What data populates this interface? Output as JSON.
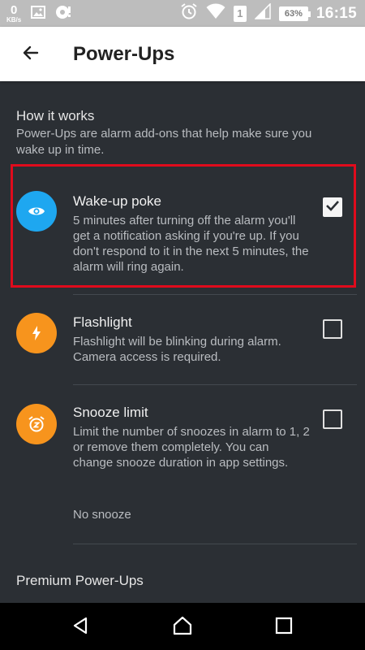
{
  "status_bar": {
    "speed_value": "0",
    "speed_unit": "KB/s",
    "sim_slot": "1",
    "battery_percent": "63%",
    "time": "16:15"
  },
  "app_bar": {
    "title": "Power-Ups"
  },
  "how_it_works": {
    "heading": "How it works",
    "description": "Power-Ups are alarm add-ons that help make sure you wake up in time."
  },
  "power_ups": [
    {
      "title": "Wake-up poke",
      "description": "5 minutes after turning off the alarm you'll get a notification asking if you're up. If you don't respond to it in the next 5 minutes, the alarm will ring again.",
      "checked": true,
      "icon": "eye-icon",
      "color": "#1ea7f0"
    },
    {
      "title": "Flashlight",
      "description": "Flashlight will be blinking during alarm. Camera access is required.",
      "checked": false,
      "icon": "lightning-icon",
      "color": "#f7941d"
    },
    {
      "title": "Snooze limit",
      "description": "Limit the number of snoozes in alarm to 1, 2 or remove them completely. You can change snooze duration in app settings.",
      "checked": false,
      "icon": "snooze-alarm-icon",
      "color": "#f7941d",
      "value": "No snooze"
    }
  ],
  "premium": {
    "heading": "Premium Power-Ups"
  },
  "colors": {
    "background": "#2b2f34",
    "highlight_border": "#e00b1c",
    "status_bar": "#bdbdbd"
  }
}
